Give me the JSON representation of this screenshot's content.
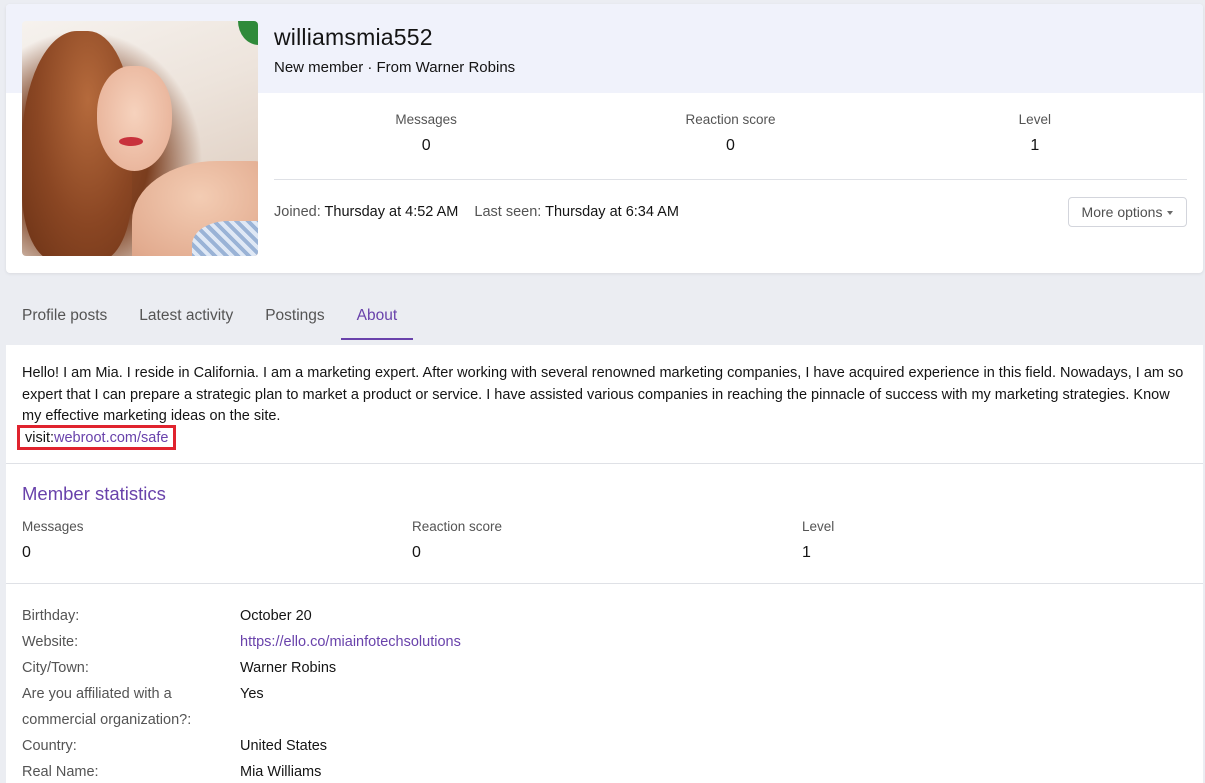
{
  "profile": {
    "username": "williamsmia552",
    "subtitle": "New member · From Warner Robins",
    "stats": [
      {
        "label": "Messages",
        "value": "0"
      },
      {
        "label": "Reaction score",
        "value": "0"
      },
      {
        "label": "Level",
        "value": "1"
      }
    ],
    "joined_label": "Joined:",
    "joined_value": "Thursday at 4:52 AM",
    "last_seen_label": "Last seen:",
    "last_seen_value": "Thursday at 6:34 AM",
    "more_options_label": "More options"
  },
  "tabs": [
    {
      "label": "Profile posts",
      "active": false
    },
    {
      "label": "Latest activity",
      "active": false
    },
    {
      "label": "Postings",
      "active": false
    },
    {
      "label": "About",
      "active": true
    }
  ],
  "about": {
    "bio": "Hello! I am Mia. I reside in California. I am a marketing expert. After working with several renowned marketing companies, I have acquired experience in this field. Nowadays, I am so expert that I can prepare a strategic plan to market a product or service. I have assisted various companies in reaching the pinnacle of success with my marketing strategies. Know my effective marketing ideas on the site.",
    "visit_prefix": "visit:",
    "visit_link": "webroot.com/safe",
    "member_statistics_title": "Member statistics",
    "member_stats": [
      {
        "label": "Messages",
        "value": "0"
      },
      {
        "label": "Reaction score",
        "value": "0"
      },
      {
        "label": "Level",
        "value": "1"
      }
    ],
    "info": [
      {
        "key": "Birthday:",
        "value": "October 20"
      },
      {
        "key": "Website:",
        "value": "https://ello.co/miainfotechsolutions"
      },
      {
        "key": "City/Town:",
        "value": "Warner Robins"
      },
      {
        "key": "Are you affiliated with a",
        "value": "Yes"
      },
      {
        "key": "commercial organization?:",
        "value": ""
      },
      {
        "key": "Country:",
        "value": "United States"
      },
      {
        "key": "Real Name:",
        "value": "Mia Williams"
      }
    ]
  },
  "colors": {
    "accent": "#6942ab",
    "highlight_box": "#e0232e",
    "banner": "#f0f2fb",
    "page_bg": "#ebedf2"
  }
}
